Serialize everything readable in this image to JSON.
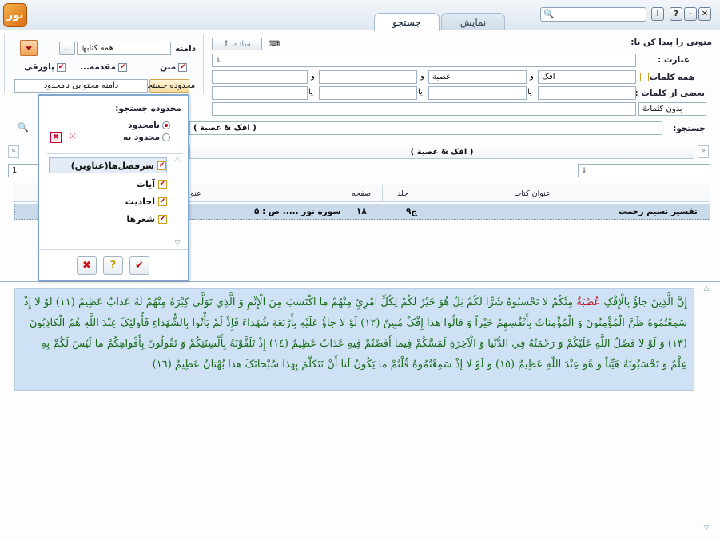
{
  "window": {
    "logo_text": "نور",
    "tabs": [
      {
        "label": "جستجو",
        "active": true
      },
      {
        "label": "نمایش",
        "active": false
      }
    ],
    "help_label": "?",
    "minimize_label": "–",
    "close_label": "✕",
    "info_label": "!"
  },
  "search": {
    "find_label": "متونی را پیدا کن با:",
    "phrase_label": "عبارت :",
    "mode_label": "ساده",
    "all_words_label": "همه کلمات :",
    "some_words_label": "بعضی از کلمات :",
    "and_label": "و",
    "or_label": "یا",
    "all_words_values": [
      "افک",
      "عصبة",
      "",
      ""
    ],
    "no_words_value": "بدون کلمات",
    "query_label": "جستجو:",
    "query_value": "( افک & عصبة )"
  },
  "scope": {
    "domain_label": "دامنه",
    "domain_value": "همه کتابها",
    "more_label": "...",
    "checks": [
      {
        "label": "متن",
        "checked": true
      },
      {
        "label": "مقدمه...",
        "checked": true
      },
      {
        "label": "پاورقی",
        "checked": true
      }
    ],
    "search_scope_button": "محدوده جستجو",
    "content_scope_value": "دامنه محتوایی نامحدود"
  },
  "popup": {
    "title": "محدوده جستجو:",
    "radios": [
      {
        "label": "نامحدود",
        "selected": true
      },
      {
        "label": "محدود به",
        "selected": false
      }
    ],
    "items": [
      {
        "label": "سرفصل‌ها(عناوین)",
        "checked": true,
        "selected": true
      },
      {
        "label": "آیات",
        "checked": true,
        "selected": false
      },
      {
        "label": "احادیث",
        "checked": true,
        "selected": false
      },
      {
        "label": "شعرها",
        "checked": true,
        "selected": false
      }
    ],
    "ok_label": "✔",
    "help_label": "?",
    "cancel_label": "✖"
  },
  "results": {
    "query_tab": "( افک & عصبة )",
    "page_value": "1",
    "columns": [
      "عنوان کتاب",
      "جلد",
      "صفحه",
      "عنو"
    ],
    "rows": [
      {
        "title": "تفسیر نسیم رحمت",
        "volume": "ج۹",
        "page": "۱۸",
        "location": "سوره نور ..... ص : ۵"
      }
    ]
  },
  "passage": {
    "before": "إِنَّ الَّذِینَ جاؤُ بِالْإِفْکِ ",
    "highlight": "عُصْبَةٌ",
    "after": " مِنْکُمْ لا تَحْسَبُوهُ شَرًّا لَکُمْ بَلْ هُوَ خَیْرٌ لَکُمْ لِکُلِّ امْرِئٍ مِنْهُمْ مَا اکْتَسَبَ مِنَ الْإِثْمِ وَ الَّذِي تَوَلَّى کِبْرَهُ مِنْهُمْ لَهُ عَذابٌ عَظِیمٌ (١١) لَوْ لا إِذْ سَمِعْتُمُوهُ ظَنَّ الْمُؤْمِنُونَ وَ الْمُؤْمِناتُ بِأَنْفُسِهِمْ خَیْراً وَ قالُوا هذا إِفْکٌ مُبِینٌ (١٢) لَوْ لا جاؤُ عَلَیْهِ بِأَرْبَعَةِ شُهَداءَ فَإِذْ لَمْ یَأْتُوا بِالشُّهَداءِ فَأُولئِکَ عِنْدَ اللَّهِ هُمُ الْکاذِبُونَ (١٣) وَ لَوْ لا فَضْلُ اللَّهِ عَلَیْکُمْ وَ رَحْمَتُهُ فِي الدُّنْیا وَ الْآخِرَةِ لَمَسَّکُمْ فِیما أَفَضْتُمْ فِیهِ عَذابٌ عَظِیمٌ (١٤) إِذْ تَلَقَّوْنَهُ بِأَلْسِنَتِکُمْ وَ تَقُولُونَ بِأَفْواهِکُمْ ما لَیْسَ لَکُمْ بِهِ عِلْمٌ وَ تَحْسَبُونَهُ هَیِّناً وَ هُوَ عِنْدَ اللَّهِ عَظِیمٌ (١٥) وَ لَوْ لا إِذْ سَمِعْتُمُوهُ قُلْتُمْ ما یَکُونُ لَنا أَنْ نَتَکَلَّمَ بِهذا سُبْحانَکَ هذا بُهْتانٌ عَظِیمٌ (١٦)"
  },
  "colors": {
    "accent": "#7fa7cf",
    "passage_bg": "#cfe2f5",
    "passage_text": "#1a6b1a",
    "highlight": "#c0142a",
    "row_selected": "#c9daeb"
  }
}
